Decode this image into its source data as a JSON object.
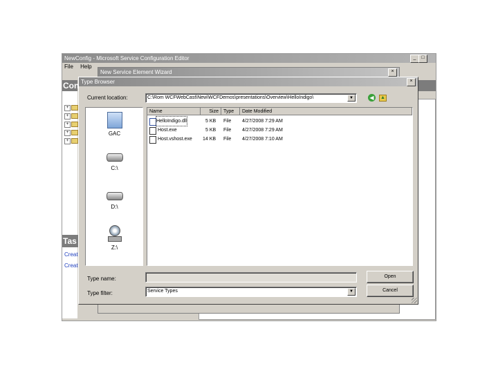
{
  "main_window": {
    "title": "NewConfig - Microsoft Service Configuration Editor",
    "menu": [
      "File",
      "Help"
    ],
    "left_header": "Con",
    "tasks_header": "Tas",
    "tasks_links": [
      "Creat",
      "Creat"
    ]
  },
  "wizard": {
    "title": "New Service Element Wizard"
  },
  "type_browser": {
    "title": "Type Browser",
    "location_label": "Current location:",
    "location_value": "C:\\Rom WCFWebCast\\New\\WCFDemos\\presentations\\Overview\\HelloIndigo\\",
    "places": [
      {
        "icon": "gac-icon",
        "label": "GAC"
      },
      {
        "icon": "drive-icon",
        "label": "C:\\"
      },
      {
        "icon": "drive-icon",
        "label": "D:\\"
      },
      {
        "icon": "removable-drive-icon",
        "label": "Z:\\"
      }
    ],
    "columns": [
      "Name",
      "Size",
      "Type",
      "Date Modified"
    ],
    "files": [
      {
        "name": "HelloIndigo.dll",
        "size": "5 KB",
        "type": "File",
        "date": "4/27/2008 7:29 AM"
      },
      {
        "name": "Host.exe",
        "size": "5 KB",
        "type": "File",
        "date": "4/27/2008 7:29 AM"
      },
      {
        "name": "Host.vshost.exe",
        "size": "14 KB",
        "type": "File",
        "date": "4/27/2008 7:10 AM"
      }
    ],
    "type_name_label": "Type name:",
    "type_name_value": "",
    "type_filter_label": "Type filter:",
    "type_filter_value": "Service Types",
    "open_label": "Open",
    "cancel_label": "Cancel",
    "back_icon": "back-arrow-icon",
    "up_icon": "up-folder-icon"
  }
}
